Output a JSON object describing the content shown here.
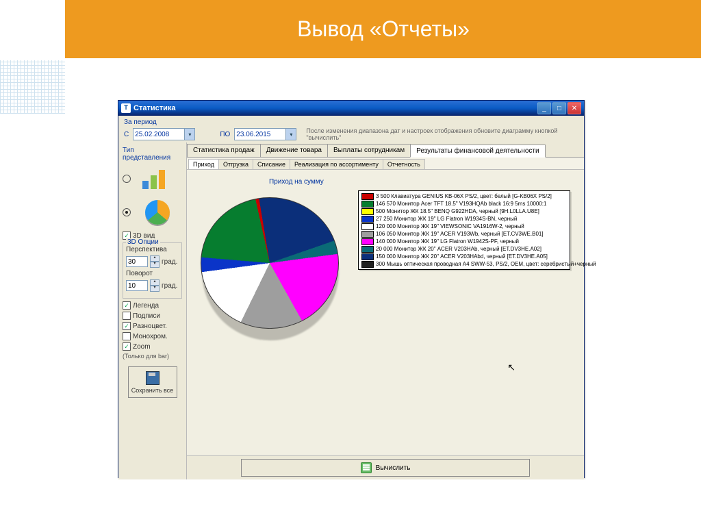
{
  "slide": {
    "title": "Вывод «Отчеты»"
  },
  "window": {
    "title": "Статистика"
  },
  "period": {
    "label": "За период",
    "from_lbl": "С",
    "from": "25.02.2008",
    "to_lbl": "ПО",
    "to": "23.06.2015",
    "hint": "После изменения диапазона дат и настроек отображения обновите диаграмму кнопкой \"вычислить\""
  },
  "left": {
    "type_lbl": "Тип представления",
    "view3d": "3D вид",
    "opts3d": "3D Опции",
    "persp_lbl": "Перспектива",
    "persp_val": "30",
    "deg": "град.",
    "rot_lbl": "Поворот",
    "rot_val": "10",
    "legend": "Легенда",
    "labels": "Подписи",
    "color": "Разноцвет.",
    "mono": "Монохром.",
    "zoom": "Zoom",
    "zoom_hint": "(Только для bar)",
    "save": "Сохранить все"
  },
  "tabs_main": [
    "Статистика продаж",
    "Движение товара",
    "Выплаты сотрудникам",
    "Результаты финансовой деятельности"
  ],
  "tabs_main_active": 3,
  "tabs_sub": [
    "Приход",
    "Отгрузка",
    "Списание",
    "Реализация по ассортименту",
    "Отчетность"
  ],
  "tabs_sub_active": 0,
  "chart_title": "Приход на сумму",
  "compute": "Вычислить",
  "chart_data": {
    "type": "pie",
    "title": "Приход на сумму",
    "series": [
      {
        "name": "3 500 Клавиатура GENIUS KB-06X PS/2, цвет: белый [G-KB06X PS/2]",
        "value": 3500,
        "color": "#c80000"
      },
      {
        "name": "146 570 Монитор Acer TFT 18.5\" V193HQAb black 16:9 5ms 10000:1",
        "value": 146570,
        "color": "#067d2f"
      },
      {
        "name": "500 Монитор ЖК 18.5\" BENQ G922HDA, черный [9H.L0LLA.U8E]",
        "value": 500,
        "color": "#ffff00"
      },
      {
        "name": "27 250 Монитор ЖК 19\" LG Flatron W1934S-BN, черный",
        "value": 27250,
        "color": "#0a34c8"
      },
      {
        "name": "120 000 Монитор ЖК 19\" VIEWSONIC VA1916W-2, черный",
        "value": 120000,
        "color": "#ffffff"
      },
      {
        "name": "106 050 Монитор ЖК 19\" ACER V193Wb, черный [ET.CV3WE.B01]",
        "value": 106050,
        "color": "#9e9e9e"
      },
      {
        "name": "140 000 Монитор ЖК 19\" LG Flatron W1942S-PF, черный",
        "value": 140000,
        "color": "#ff00ff"
      },
      {
        "name": "20 000 Монитор ЖК 20\" ACER V203HAb, черный [ET.DV3HE.A02]",
        "value": 20000,
        "color": "#0a6b76"
      },
      {
        "name": "150 000 Монитор ЖК 20\" ACER V203HAbd, черный [ET.DV3HE.A05]",
        "value": 150000,
        "color": "#0b2f7a"
      },
      {
        "name": "300 Мышь оптическая проводная A4 SWW-53, PS/2, OEM, цвет: серебристый+черный",
        "value": 300,
        "color": "#202020"
      }
    ]
  }
}
